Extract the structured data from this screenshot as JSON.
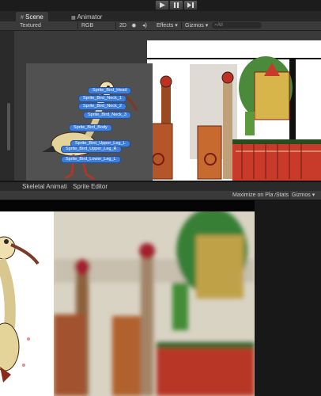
{
  "toolbar": {
    "play_icon": "play-icon",
    "pause_icon": "pause-icon",
    "step_icon": "step-icon"
  },
  "tabs": {
    "scene": "Scene",
    "animator": "Animator"
  },
  "scene_toolbar": {
    "draw_mode": "Textured",
    "render_mode": "RGB",
    "mode_2d": "2D",
    "effects": "Effects",
    "gizmos": "Gizmos",
    "search_placeholder": "All"
  },
  "bones": [
    "Sprite_Bird_Head",
    "Sprite_Bird_Neck_1",
    "Sprite_Bird_Neck_2",
    "Sprite_Bird_Neck_3",
    "Sprite_Bird_Body",
    "Sprite_Bird_Upper_Leg_L",
    "Sprite_Bird_Upper_Leg_R",
    "Sprite_Bird_Lower_Leg_L"
  ],
  "panel_tabs": {
    "skeletal": "Skeletal Animati",
    "sprite_editor": "Sprite Editor"
  },
  "game_toolbar": {
    "maximize": "Maximize on Play",
    "stats": "Stats",
    "gizmos": "Gizmos"
  },
  "colors": {
    "bone_blue": "#3f7fd8",
    "editor_bg": "#3a3a3a",
    "window_bg": "#1a1a1a"
  }
}
